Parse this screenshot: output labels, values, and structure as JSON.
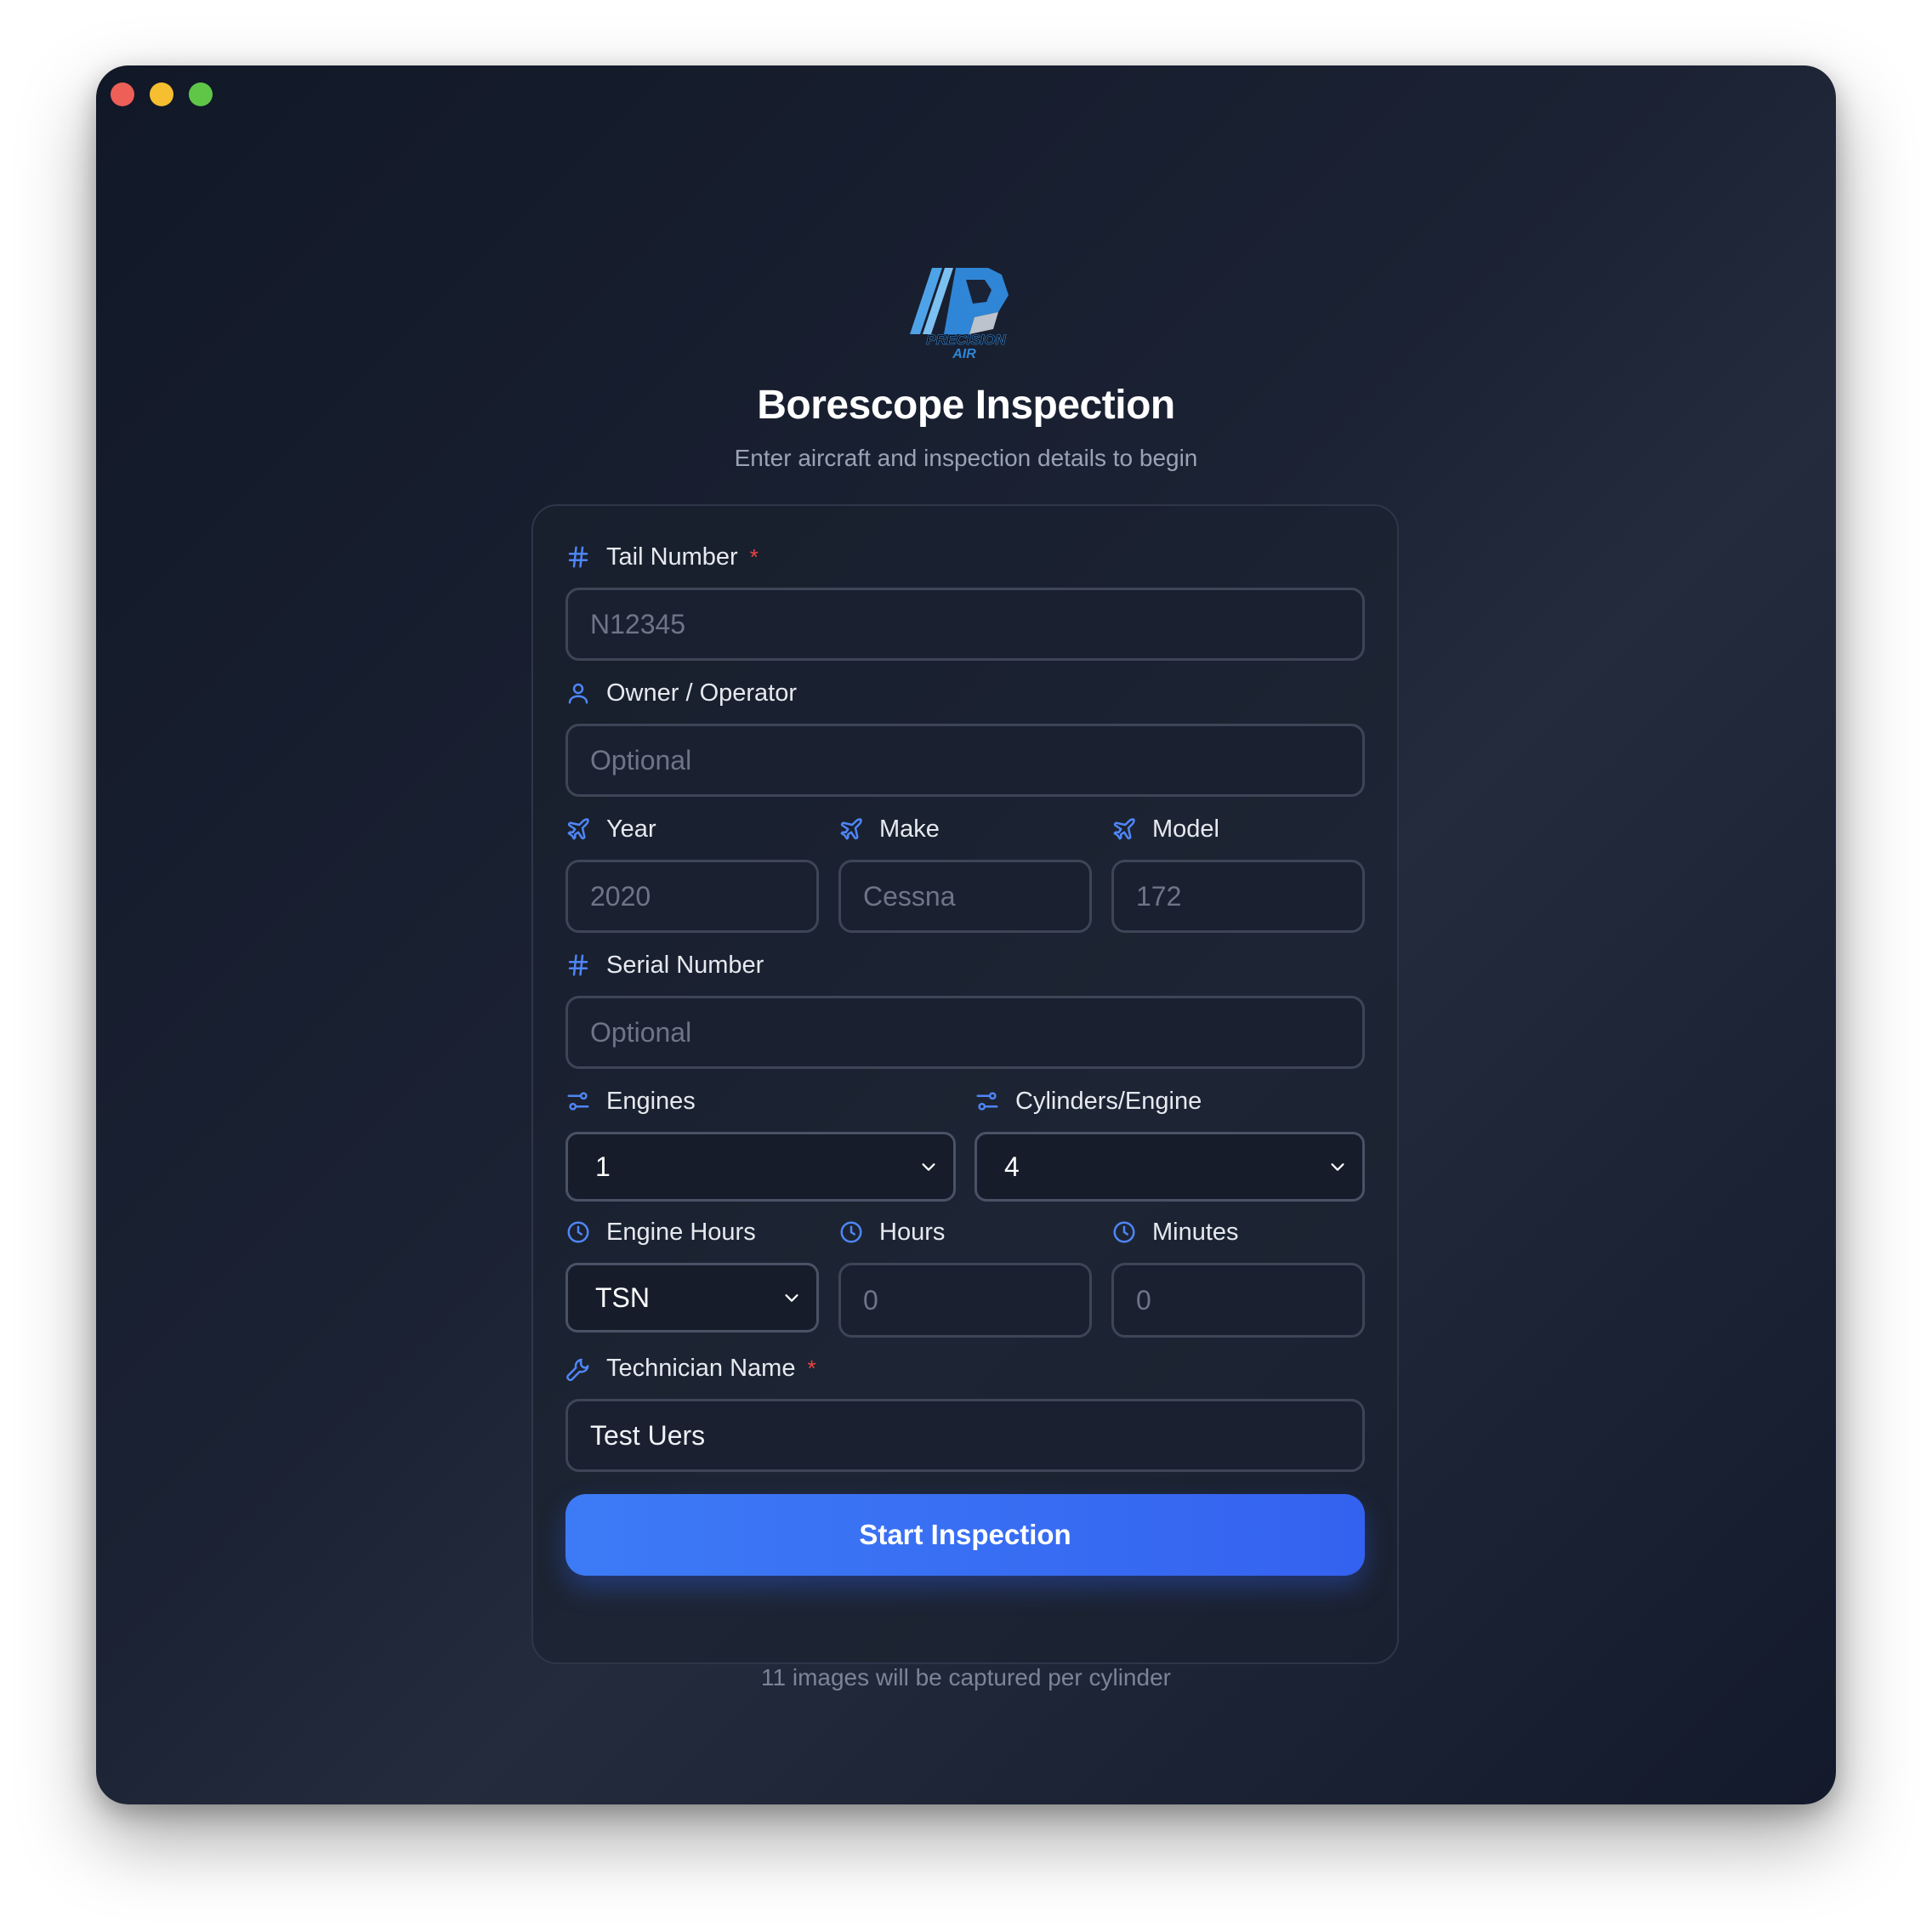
{
  "app": {
    "brand_colors": {
      "accent": "#3b82f6",
      "button": "#3d6df3",
      "required": "#ef4444"
    },
    "logo_text": [
      "PRECISION",
      "AIR"
    ]
  },
  "header": {
    "title": "Borescope Inspection",
    "subtitle": "Enter aircraft and inspection details to begin"
  },
  "form": {
    "tail_number": {
      "label": "Tail Number",
      "required_mark": "*",
      "placeholder": "N12345",
      "icon": "hash-icon"
    },
    "owner": {
      "label": "Owner / Operator",
      "placeholder": "Optional",
      "icon": "user-icon"
    },
    "year": {
      "label": "Year",
      "placeholder": "2020",
      "icon": "plane-icon"
    },
    "make": {
      "label": "Make",
      "placeholder": "Cessna",
      "icon": "plane-icon"
    },
    "model": {
      "label": "Model",
      "placeholder": "172",
      "icon": "plane-icon"
    },
    "serial": {
      "label": "Serial Number",
      "placeholder": "Optional",
      "icon": "hash-icon"
    },
    "engines": {
      "label": "Engines",
      "value": "1",
      "icon": "sliders-icon"
    },
    "cylinders": {
      "label": "Cylinders/Engine",
      "value": "4",
      "icon": "sliders-icon"
    },
    "engine_hours": {
      "label": "Engine Hours",
      "value": "TSN",
      "icon": "clock-icon"
    },
    "hours": {
      "label": "Hours",
      "placeholder": "0",
      "icon": "clock-icon"
    },
    "minutes": {
      "label": "Minutes",
      "placeholder": "0",
      "icon": "clock-icon"
    },
    "technician": {
      "label": "Technician Name",
      "required_mark": "*",
      "value": "Test Uers",
      "icon": "wrench-icon"
    },
    "submit_label": "Start Inspection",
    "footnote": "11 images will be captured per cylinder"
  }
}
